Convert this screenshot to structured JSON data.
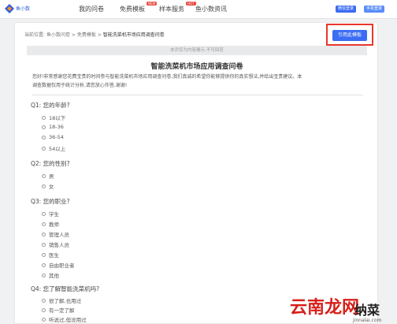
{
  "logo": {
    "text": "鱼小数"
  },
  "nav": {
    "items": [
      "我的问卷",
      "免费模板",
      "样本服务",
      "鱼小数资讯"
    ],
    "badge_new": "NEW",
    "badge_hot": "HOT"
  },
  "auth": {
    "wechat_login": "微信登录",
    "phone_login": "手机登录"
  },
  "breadcrumb": {
    "prefix": "当前位置:",
    "home": "鱼小数问卷",
    "sep": ">",
    "templates": "免费模板",
    "current": "智能洗菜机市场应用调查问卷"
  },
  "use_template_button": "引用此模板",
  "notice": "本页仅为内容展示,不可回答",
  "survey": {
    "title": "智能洗菜机市场应用调查问卷",
    "intro_line1": "您好!非常感谢您花费宝贵的时间参与智能洗菜机市场应用调查问卷,我们真诚的希望你能够提供你的真实想法,并给出宝贵建议。本",
    "intro_line2": "调查数据仅用于统计分析,请您放心作答,谢谢!",
    "questions": [
      {
        "label": "Q1: 您的年龄?",
        "options": [
          "18以下",
          "18-36",
          "36-54",
          "54以上"
        ]
      },
      {
        "label": "Q2: 您的性别?",
        "options": [
          "男",
          "女"
        ]
      },
      {
        "label": "Q3: 您的职业?",
        "options": [
          "学生",
          "教师",
          "管理人员",
          "销售人员",
          "医生",
          "自由职业者",
          "其他"
        ]
      },
      {
        "label": "Q4: 您了解智能洗菜机吗?",
        "options": [
          "很了解,也用过",
          "有一定了解",
          "听说过,但没用过"
        ]
      }
    ]
  },
  "watermark": {
    "brand": "云南龙网",
    "mark": "纳菜",
    "url": "jinnalai.com"
  },
  "colors": {
    "accent": "#3a6cf4",
    "highlight_frame": "#e8372d",
    "watermark": "#d7201a"
  }
}
